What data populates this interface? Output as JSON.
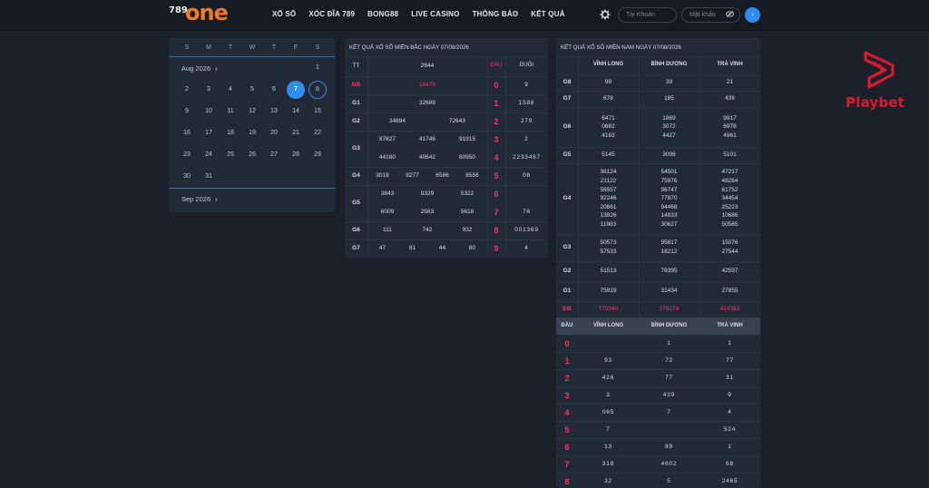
{
  "brand": {
    "logo_num": "789",
    "logo_word": "one"
  },
  "nav": [
    "XỔ SỐ",
    "XÓC ĐĨA 789",
    "BONG88",
    "LIVE CASINO",
    "THÔNG BÁO",
    "KẾT QUẢ"
  ],
  "login": {
    "user_placeholder": "Tài Khoản",
    "pass_placeholder": "Mật khẩu",
    "go_label": "›"
  },
  "calendar": {
    "weekdays": [
      "S",
      "M",
      "T",
      "W",
      "T",
      "F",
      "S"
    ],
    "month1": "Aug 2026",
    "month2": "Sep 2026",
    "selected_day": "7",
    "ringed_day": "8"
  },
  "bac": {
    "title": "KẾT QUẢ XỔ SỐ MIỀN BẮC NGÀY 07/08/2026",
    "head_tt": "TT",
    "head_code": "2844",
    "head_dau": "ĐẦU",
    "head_duoi": "ĐUÔI",
    "prizes": [
      {
        "label": "ĐB",
        "values": [
          "16479"
        ],
        "red": true
      },
      {
        "label": "G1",
        "values": [
          "32689"
        ]
      },
      {
        "label": "G2",
        "values": [
          "34894",
          "72643"
        ]
      },
      {
        "label": "G3",
        "values": [
          "87827",
          "41746",
          "91915",
          "44180",
          "40642",
          "80950"
        ]
      },
      {
        "label": "G4",
        "values": [
          "3018",
          "8277",
          "6586",
          "6556"
        ]
      },
      {
        "label": "G5",
        "values": [
          "3843",
          "9329",
          "5322",
          "6009",
          "2583",
          "5618"
        ]
      },
      {
        "label": "G6",
        "values": [
          "111",
          "742",
          "932"
        ]
      },
      {
        "label": "G7",
        "values": [
          "47",
          "81",
          "44",
          "80"
        ]
      }
    ],
    "dau": [
      "0",
      "1",
      "2",
      "3",
      "4",
      "5",
      "6",
      "7",
      "8",
      "9"
    ],
    "duoi": [
      "9",
      "1588",
      "279",
      "2",
      "2233467",
      "06",
      "",
      "76",
      "001369",
      "4"
    ]
  },
  "nam": {
    "title": "KẾT QUẢ XỔ SỐ MIỀN NAM NGÀY 07/08/2026",
    "provinces": [
      "VĨNH LONG",
      "BÌNH DƯƠNG",
      "TRÀ VINH"
    ],
    "prizes": [
      {
        "label": "G8",
        "cols": [
          [
            "99"
          ],
          [
            "39"
          ],
          [
            "21"
          ]
        ]
      },
      {
        "label": "G7",
        "cols": [
          [
            "678"
          ],
          [
            "185"
          ],
          [
            "439"
          ]
        ]
      },
      {
        "label": "G6",
        "cols": [
          [
            "6471",
            "0682",
            "4163"
          ],
          [
            "1869",
            "3072",
            "4427"
          ],
          [
            "9917",
            "6978",
            "4961"
          ]
        ]
      },
      {
        "label": "G5",
        "cols": [
          [
            "5145"
          ],
          [
            "3096"
          ],
          [
            "5101"
          ]
        ]
      },
      {
        "label": "G4",
        "cols": [
          [
            "36124",
            "21122",
            "56557",
            "92246",
            "20861",
            "13926",
            "11983"
          ],
          [
            "54501",
            "75976",
            "96747",
            "77870",
            "94468",
            "14833",
            "30627"
          ],
          [
            "47217",
            "48284",
            "61752",
            "34454",
            "25223",
            "10686",
            "50585"
          ]
        ]
      },
      {
        "label": "G3",
        "cols": [
          [
            "50573",
            "57533"
          ],
          [
            "95817",
            "18212"
          ],
          [
            "15076",
            "27544"
          ]
        ]
      },
      {
        "label": "G2",
        "cols": [
          [
            "51513"
          ],
          [
            "78395"
          ],
          [
            "42597"
          ]
        ]
      },
      {
        "label": "G1",
        "cols": [
          [
            "75919"
          ],
          [
            "31434"
          ],
          [
            "27855"
          ]
        ]
      },
      {
        "label": "ĐB",
        "cols": [
          [
            "779340"
          ],
          [
            "276274"
          ],
          [
            "414383"
          ]
        ],
        "red": true
      }
    ],
    "dau_head": "ĐẦU",
    "dau_rows": [
      {
        "d": "0",
        "v": [
          "",
          "1",
          "1"
        ]
      },
      {
        "d": "1",
        "v": [
          "93",
          "72",
          "77"
        ]
      },
      {
        "d": "2",
        "v": [
          "426",
          "77",
          "31"
        ]
      },
      {
        "d": "3",
        "v": [
          "3",
          "439",
          "9"
        ]
      },
      {
        "d": "4",
        "v": [
          "065",
          "7",
          "4"
        ]
      },
      {
        "d": "5",
        "v": [
          "7",
          "",
          "524"
        ]
      },
      {
        "d": "6",
        "v": [
          "13",
          "89",
          "1"
        ]
      },
      {
        "d": "7",
        "v": [
          "318",
          "4602",
          "68"
        ]
      },
      {
        "d": "8",
        "v": [
          "32",
          "5",
          "2465"
        ]
      }
    ]
  },
  "ad": {
    "text": "Playbet",
    "color": "#e0182d"
  }
}
